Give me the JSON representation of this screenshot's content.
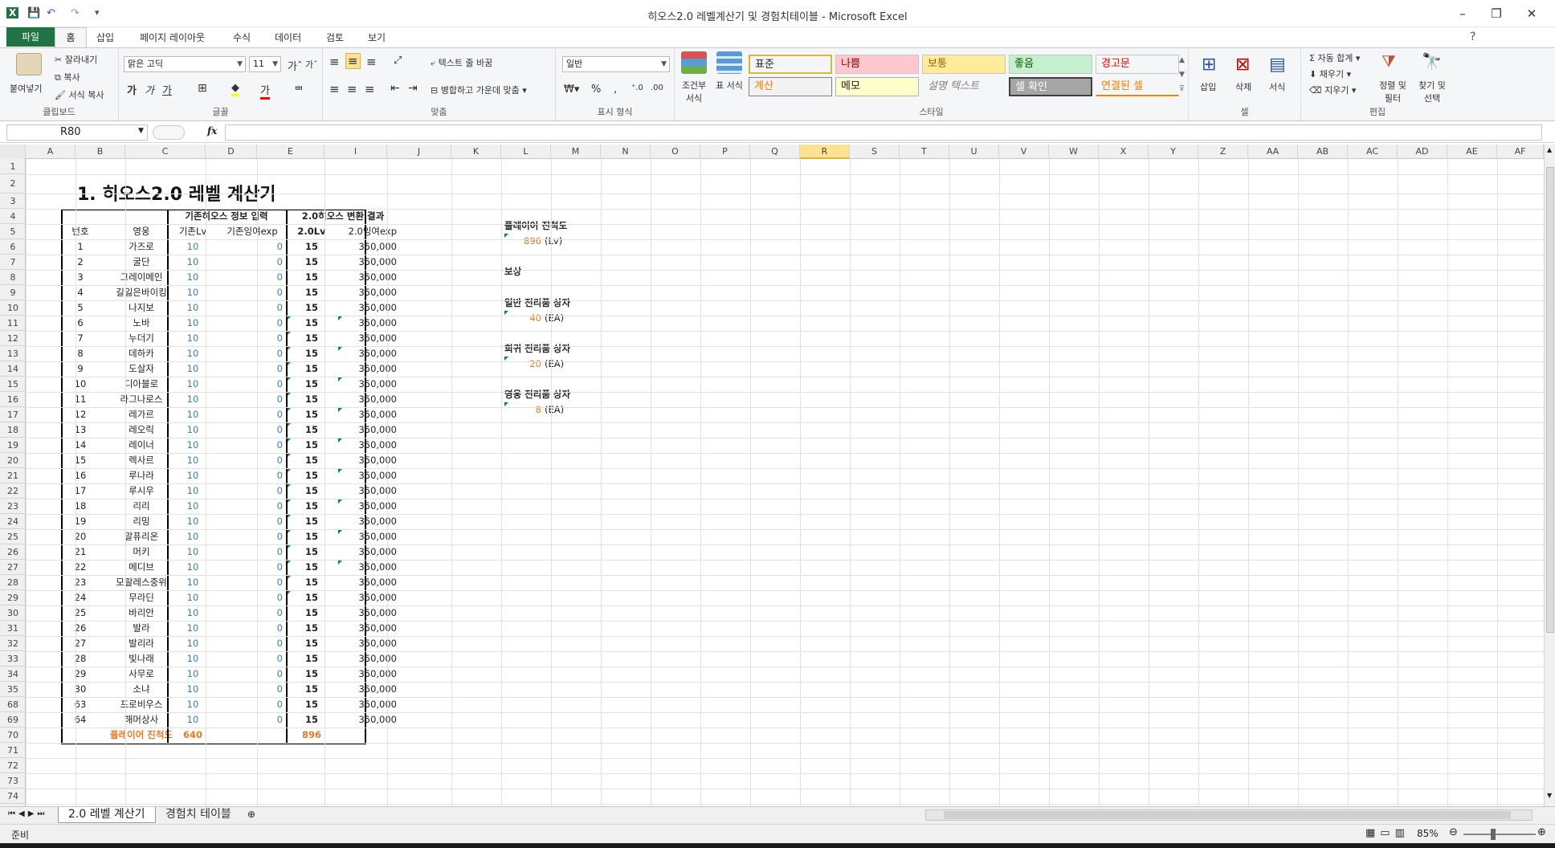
{
  "window": {
    "title": "히오스2.0 레벨계산기 및 경험치테이블 - Microsoft Excel",
    "minimize": "–",
    "restore": "❐",
    "close": "✕"
  },
  "ribbon_tabs": [
    "파일",
    "홈",
    "삽입",
    "페이지 레이아웃",
    "수식",
    "데이터",
    "검토",
    "보기"
  ],
  "clipboard": {
    "paste": "붙여넣기",
    "cut": "잘라내기",
    "copy": "복사",
    "format_painter": "서식 복사",
    "label": "클립보드"
  },
  "font": {
    "name": "맑은 고딕",
    "size": "11",
    "bold": "가",
    "italic": "가",
    "underline": "가",
    "label": "글꼴"
  },
  "alignment": {
    "wrap": "텍스트 줄 바꿈",
    "merge": "병합하고 가운데 맞춤",
    "label": "맞춤"
  },
  "number": {
    "format": "일반",
    "label": "표시 형식"
  },
  "styles": {
    "conditional": "조건부 서식",
    "table": "표 서식",
    "items": [
      {
        "label": "표준",
        "bg": "#ffffff",
        "fg": "#000000"
      },
      {
        "label": "나쁨",
        "bg": "#ffc7ce",
        "fg": "#9c0006"
      },
      {
        "label": "보통",
        "bg": "#ffeb9c",
        "fg": "#9c6500"
      },
      {
        "label": "좋음",
        "bg": "#c6efce",
        "fg": "#006100"
      },
      {
        "label": "경고문",
        "bg": "#ffffff",
        "fg": "#ff0000"
      },
      {
        "label": "계산",
        "bg": "#f2f2f2",
        "fg": "#fa7d00"
      },
      {
        "label": "메모",
        "bg": "#ffffcc",
        "fg": "#000000"
      },
      {
        "label": "설명 텍스트",
        "bg": "#ffffff",
        "fg": "#7f7f7f"
      },
      {
        "label": "셀 확인",
        "bg": "#a5a5a5",
        "fg": "#ffffff"
      },
      {
        "label": "연결된 셀",
        "bg": "#ffffff",
        "fg": "#fa7d00"
      }
    ],
    "label": "스타일"
  },
  "cells_group": {
    "insert": "삽입",
    "delete": "삭제",
    "format": "서식",
    "label": "셀"
  },
  "editing": {
    "autosum": "Σ 자동 합계",
    "fill": "채우기",
    "clear": "지우기",
    "sort": "정렬 및 필터",
    "find": "찾기 및 선택",
    "label": "편집"
  },
  "formula_bar": {
    "name_box": "R80",
    "fx": "fx",
    "value": ""
  },
  "columns": [
    "A",
    "B",
    "C",
    "D",
    "E",
    "I",
    "J",
    "K",
    "L",
    "M",
    "N",
    "O",
    "P",
    "Q",
    "R",
    "S",
    "T",
    "U",
    "V",
    "W",
    "X",
    "Y",
    "Z",
    "AA",
    "AB",
    "AC",
    "AD",
    "AE",
    "AF"
  ],
  "row_numbers": [
    "1",
    "2",
    "3",
    "4",
    "5",
    "6",
    "7",
    "8",
    "9",
    "10",
    "11",
    "12",
    "13",
    "14",
    "15",
    "16",
    "17",
    "18",
    "19",
    "20",
    "21",
    "22",
    "23",
    "24",
    "25",
    "26",
    "27",
    "28",
    "29",
    "30",
    "31",
    "32",
    "33",
    "34",
    "35",
    "68",
    "69",
    "70",
    "71",
    "72",
    "73",
    "74"
  ],
  "sheet": {
    "title": "1. 히오스2.0 레벨 계산기",
    "header_group1": "기존히오스 정보 입력",
    "header_group2": "2.0히오스 변환 결과",
    "col_no": "번호",
    "col_hero": "영웅",
    "col_lv": "기존Lv",
    "col_exp": "기존잉여exp",
    "col_lv2": "2.0Lv",
    "col_exp2": "2.0잉여exp",
    "rows": [
      [
        "1",
        "가즈로",
        "10",
        "0",
        "15",
        "350,000"
      ],
      [
        "2",
        "굴단",
        "10",
        "0",
        "15",
        "350,000"
      ],
      [
        "3",
        "그레이메인",
        "10",
        "0",
        "15",
        "350,000"
      ],
      [
        "4",
        "길잃은바이킹",
        "10",
        "0",
        "15",
        "350,000"
      ],
      [
        "5",
        "나지보",
        "10",
        "0",
        "15",
        "350,000"
      ],
      [
        "6",
        "노바",
        "10",
        "0",
        "15",
        "350,000"
      ],
      [
        "7",
        "누더기",
        "10",
        "0",
        "15",
        "350,000"
      ],
      [
        "8",
        "데하카",
        "10",
        "0",
        "15",
        "350,000"
      ],
      [
        "9",
        "도살자",
        "10",
        "0",
        "15",
        "350,000"
      ],
      [
        "10",
        "디아블로",
        "10",
        "0",
        "15",
        "350,000"
      ],
      [
        "11",
        "라그나로스",
        "10",
        "0",
        "15",
        "350,000"
      ],
      [
        "12",
        "레가르",
        "10",
        "0",
        "15",
        "350,000"
      ],
      [
        "13",
        "레오릭",
        "10",
        "0",
        "15",
        "350,000"
      ],
      [
        "14",
        "레이너",
        "10",
        "0",
        "15",
        "350,000"
      ],
      [
        "15",
        "렉사르",
        "10",
        "0",
        "15",
        "350,000"
      ],
      [
        "16",
        "루나라",
        "10",
        "0",
        "15",
        "350,000"
      ],
      [
        "17",
        "루시우",
        "10",
        "0",
        "15",
        "350,000"
      ],
      [
        "18",
        "리리",
        "10",
        "0",
        "15",
        "350,000"
      ],
      [
        "19",
        "리밍",
        "10",
        "0",
        "15",
        "350,000"
      ],
      [
        "20",
        "말퓨리온",
        "10",
        "0",
        "15",
        "350,000"
      ],
      [
        "21",
        "머키",
        "10",
        "0",
        "15",
        "350,000"
      ],
      [
        "22",
        "메디브",
        "10",
        "0",
        "15",
        "350,000"
      ],
      [
        "23",
        "모랄레스중위",
        "10",
        "0",
        "15",
        "350,000"
      ],
      [
        "24",
        "무라딘",
        "10",
        "0",
        "15",
        "350,000"
      ],
      [
        "25",
        "바리안",
        "10",
        "0",
        "15",
        "350,000"
      ],
      [
        "26",
        "발라",
        "10",
        "0",
        "15",
        "350,000"
      ],
      [
        "27",
        "발리라",
        "10",
        "0",
        "15",
        "350,000"
      ],
      [
        "28",
        "빛나래",
        "10",
        "0",
        "15",
        "350,000"
      ],
      [
        "29",
        "사무로",
        "10",
        "0",
        "15",
        "350,000"
      ],
      [
        "30",
        "소냐",
        "10",
        "0",
        "15",
        "350,000"
      ],
      [
        "63",
        "프로비우스",
        "10",
        "0",
        "15",
        "350,000"
      ],
      [
        "64",
        "해머상사",
        "10",
        "0",
        "15",
        "350,000"
      ]
    ],
    "total_label": "플레이어 진척도",
    "total_lv": "640",
    "total_lv2": "896"
  },
  "side": {
    "progress_label": "플레이어 진척도",
    "progress_value": "896",
    "progress_unit": "(Lv)",
    "reward_label": "보상",
    "normal_label": "일반 전리품 상자",
    "normal_value": "40",
    "normal_unit": "(EA)",
    "rare_label": "희귀 전리품 상자",
    "rare_value": "20",
    "rare_unit": "(EA)",
    "hero_label": "영웅 전리품 상자",
    "hero_value": "8",
    "hero_unit": "(EA)"
  },
  "sheet_tabs": [
    "2.0 레벨 계산기",
    "경험치 테이블"
  ],
  "status": {
    "ready": "준비",
    "zoom": "85%"
  }
}
